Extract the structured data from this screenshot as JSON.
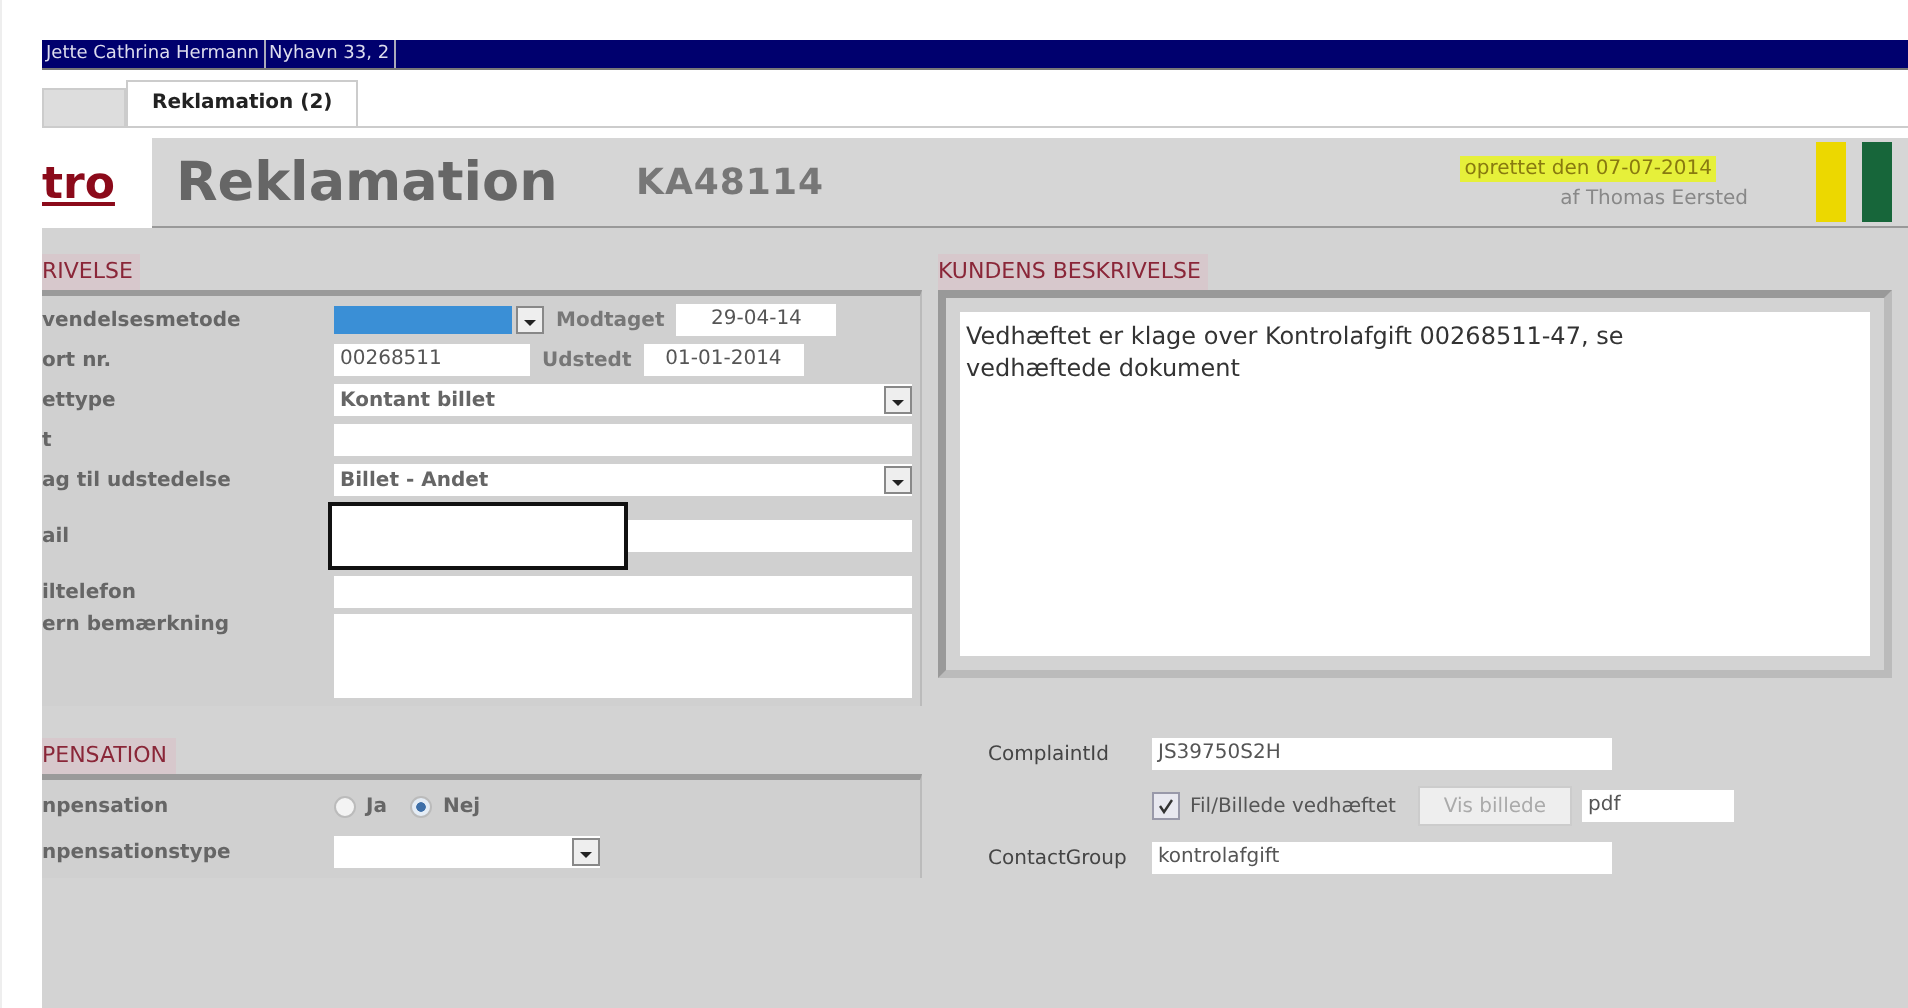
{
  "customer_bar": {
    "name": "Jette Cathrina Hermann",
    "address": "Nyhavn 33, 2"
  },
  "tabs": [
    {
      "label": "Reklamation (2)",
      "selected": true
    }
  ],
  "header": {
    "logo": "tro",
    "title": "Reklamation",
    "case_number": "KA48114",
    "created": "oprettet den 07-07-2014",
    "author": "af Thomas Eersted",
    "status_flags": [
      {
        "color": "#ecd800"
      },
      {
        "color": "#17663a"
      }
    ]
  },
  "description": {
    "heading": "RIVELSE",
    "rows": [
      {
        "label": "vendelsesmetode",
        "kind": "combo",
        "highlighted": true,
        "extra": {
          "label": "Modtaget",
          "value": "29-04-14"
        }
      },
      {
        "label": "ort nr.",
        "kind": "text",
        "value": "00268511",
        "extra": {
          "label": "Udstedt",
          "value": "01-01-2014"
        }
      },
      {
        "label": "ettype",
        "kind": "combo",
        "value": "Kontant billet"
      },
      {
        "label": "t",
        "kind": "text"
      },
      {
        "label": "ag til udstedelse",
        "kind": "combo",
        "value": "Billet - Andet"
      },
      {
        "label": "ail",
        "kind": "text",
        "redacted": true
      },
      {
        "label": "iltelefon",
        "kind": "text"
      },
      {
        "label": "ern bemærkning",
        "kind": "memo"
      }
    ]
  },
  "customer_description": {
    "heading": "KUNDENS BESKRIVELSE",
    "text": "Vedhæftet er klage over Kontrolafgift 00268511-47, se vedhæftede dokument"
  },
  "compensation": {
    "heading": "PENSATION",
    "rows": [
      {
        "label": "npensation",
        "kind": "radio",
        "options": [
          {
            "label": "Ja",
            "selected": false
          },
          {
            "label": "Nej",
            "selected": true
          }
        ]
      },
      {
        "label": "npensationstype",
        "kind": "combo"
      }
    ]
  },
  "complaint": {
    "id_label": "ComplaintId",
    "id_value": "JS39750S2H",
    "attachment": {
      "label": "Fil/Billede vedhæftet",
      "checked": true
    },
    "view_button": {
      "label": "Vis billede",
      "disabled": true
    },
    "file_type": "pdf",
    "group_label": "ContactGroup",
    "group_value": "kontrolafgift"
  }
}
